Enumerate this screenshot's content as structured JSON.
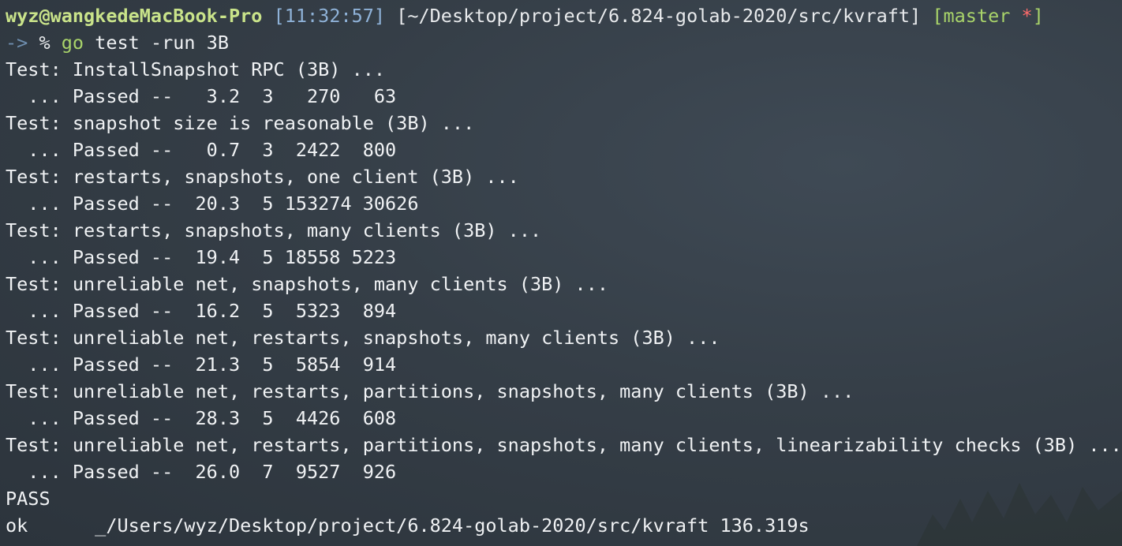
{
  "prompt": {
    "user_host": "wyz@wangkedeMacBook-Pro",
    "time": "[11:32:57]",
    "cwd": "[~/Desktop/project/6.824-golab-2020/src/kvraft]",
    "branch_open": "[",
    "branch": "master",
    "dirty_marker": "*",
    "branch_close": "]",
    "arrow": "->",
    "percent": "%",
    "command": "go",
    "command_args": "test -run 3B"
  },
  "output_lines": [
    "Test: InstallSnapshot RPC (3B) ...",
    "  ... Passed --   3.2  3   270   63",
    "Test: snapshot size is reasonable (3B) ...",
    "  ... Passed --   0.7  3  2422  800",
    "Test: restarts, snapshots, one client (3B) ...",
    "  ... Passed --  20.3  5 153274 30626",
    "Test: restarts, snapshots, many clients (3B) ...",
    "  ... Passed --  19.4  5 18558 5223",
    "Test: unreliable net, snapshots, many clients (3B) ...",
    "  ... Passed --  16.2  5  5323  894",
    "Test: unreliable net, restarts, snapshots, many clients (3B) ...",
    "  ... Passed --  21.3  5  5854  914",
    "Test: unreliable net, restarts, partitions, snapshots, many clients (3B) ...",
    "  ... Passed --  28.3  5  4426  608",
    "Test: unreliable net, restarts, partitions, snapshots, many clients, linearizability checks (3B) ...",
    "  ... Passed --  26.0  7  9527  926",
    "PASS",
    "ok      _/Users/wyz/Desktop/project/6.824-golab-2020/src/kvraft 136.319s"
  ],
  "colors": {
    "background": "#353e47",
    "text": "#f0f2f4",
    "user": "#c9e38a",
    "time": "#8fb2d8",
    "branch": "#a9d46a",
    "dirty": "#ff6b6b",
    "arrow": "#6f8fb0"
  }
}
